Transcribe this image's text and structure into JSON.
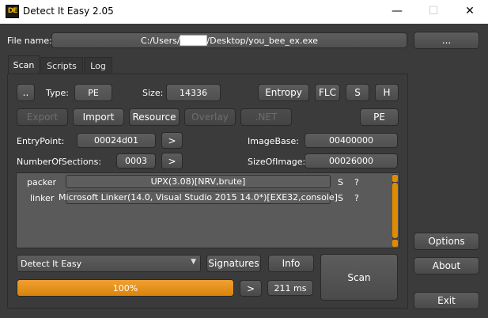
{
  "window": {
    "title": "Detect It Easy 2.05",
    "icon_text": "DE",
    "minimize": "—",
    "maximize": "☐",
    "close": "✕"
  },
  "file": {
    "label": "File name:",
    "path": "C:/Users/████/Desktop/you_bee_ex.exe",
    "browse_label": "..."
  },
  "tabs": [
    {
      "label": "Scan",
      "active": true
    },
    {
      "label": "Scripts",
      "active": false
    },
    {
      "label": "Log",
      "active": false
    }
  ],
  "scan": {
    "up_label": "..",
    "type_label": "Type:",
    "type_value": "PE",
    "size_label": "Size:",
    "size_value": "14336",
    "entropy_label": "Entropy",
    "flc_label": "FLC",
    "s_label": "S",
    "h_label": "H",
    "export_label": "Export",
    "import_label": "Import",
    "resource_label": "Resource",
    "overlay_label": "Overlay",
    "net_label": ".NET",
    "pe_label": "PE",
    "entrypoint_label": "EntryPoint:",
    "entrypoint_value": "00024d01",
    "imagebase_label": "ImageBase:",
    "imagebase_value": "00400000",
    "sections_label": "NumberOfSections:",
    "sections_value": "0003",
    "sizeofimage_label": "SizeOfImage:",
    "sizeofimage_value": "00026000",
    "arrow_label": ">",
    "results": [
      {
        "type": "packer",
        "name": "UPX(3.08)[NRV,brute]",
        "s": "S",
        "q": "?"
      },
      {
        "type": "linker",
        "name": "Microsoft Linker(14.0, Visual Studio 2015 14.0*)[EXE32,console]",
        "s": "S",
        "q": "?"
      }
    ],
    "engine_value": "Detect It Easy",
    "signatures_label": "Signatures",
    "info_label": "Info",
    "scan_label": "Scan",
    "progress_text": "100%",
    "progress": 1.0,
    "next_label": ">",
    "time_text": "211 ms"
  },
  "side": {
    "options_label": "Options",
    "about_label": "About",
    "exit_label": "Exit"
  },
  "colors": {
    "background": "#3b3b3b",
    "accent": "#e08a00"
  }
}
